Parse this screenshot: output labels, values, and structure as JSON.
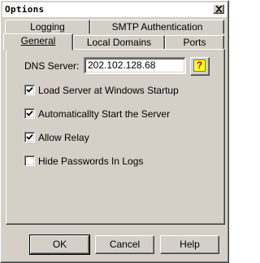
{
  "window": {
    "title": "Options"
  },
  "tabs": {
    "row_back": [
      {
        "label": "Logging",
        "accel": "L"
      },
      {
        "label": "SMTP Authentication",
        "accel": ""
      }
    ],
    "row_front": [
      {
        "label": "General",
        "accel": "G",
        "active": true
      },
      {
        "label": "Local Domains",
        "accel": "L"
      },
      {
        "label": "Ports",
        "accel": "P"
      }
    ]
  },
  "general": {
    "dns_label": "DNS Server:",
    "dns_value": "202.102.128.68",
    "checkboxes": [
      {
        "label": "Load Server at Windows Startup",
        "checked": true
      },
      {
        "label": "Automaticallty Start the Server",
        "checked": true
      },
      {
        "label": "Allow Relay",
        "checked": true
      },
      {
        "label": "Hide Passwords In Logs",
        "checked": false
      }
    ]
  },
  "buttons": {
    "ok": "OK",
    "cancel": "Cancel",
    "help": "Help"
  },
  "icons": {
    "help": "question-mark-icon",
    "close": "close-icon"
  }
}
